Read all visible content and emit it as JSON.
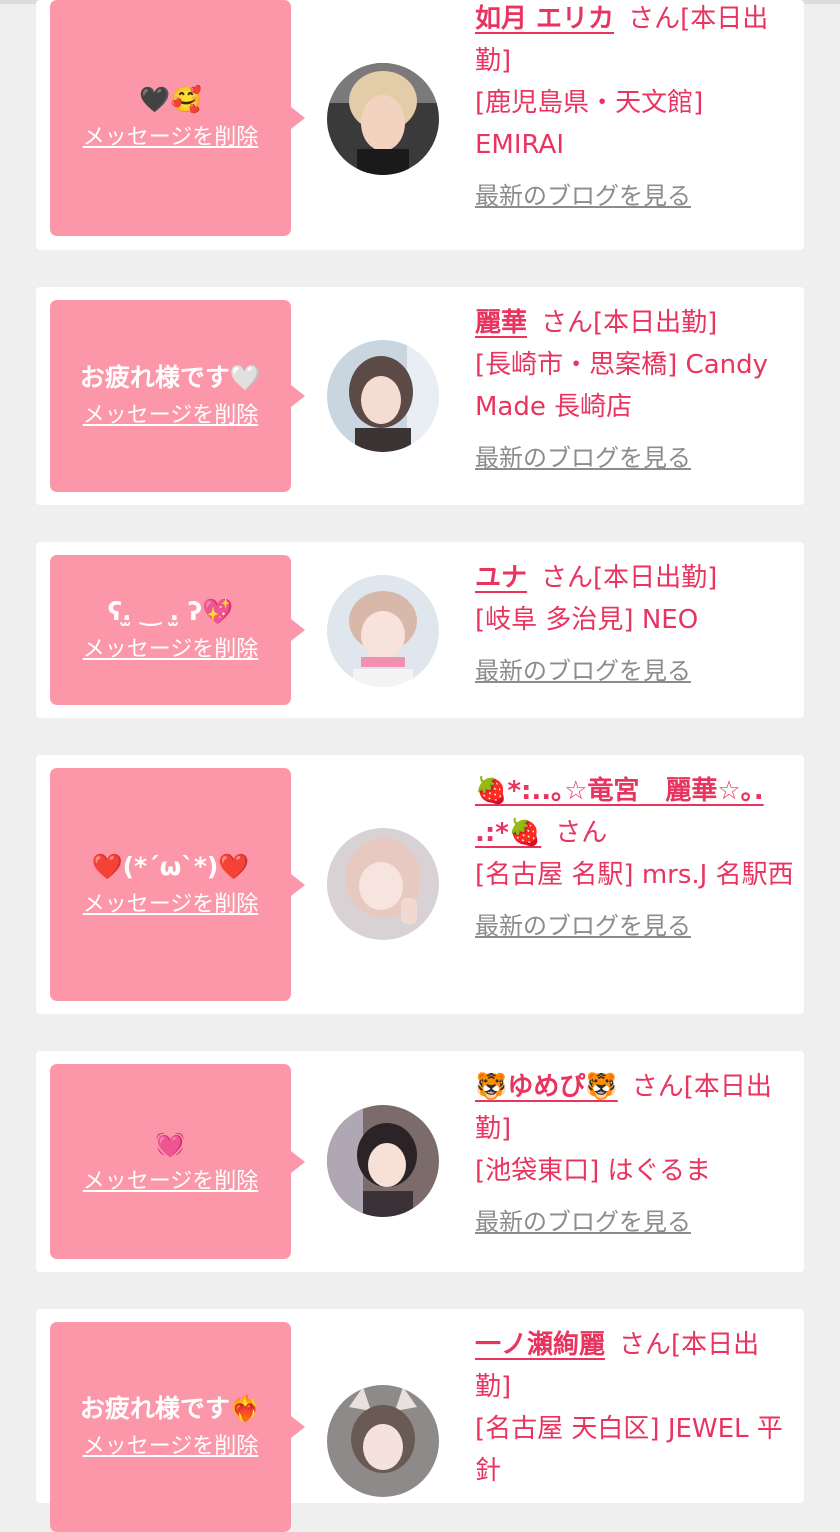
{
  "common": {
    "delete_label": "メッセージを削除",
    "blog_label": "最新のブログを見る"
  },
  "messages": [
    {
      "message": "🖤🥰",
      "name": "如月 エリカ",
      "san_attendance": "さん[本日出勤]",
      "shop": "[鹿児島県・天文館] EMIRAI"
    },
    {
      "message": "お疲れ様です🤍",
      "name": "麗華",
      "san_attendance": "さん[本日出勤]",
      "shop": "[長崎市・思案橋] Candy Made 長崎店"
    },
    {
      "message": "ʕ.̫ ‿ .̫ ʔ💖",
      "name": "ユナ",
      "san_attendance": "さん[本日出勤]",
      "shop": "[岐阜 多治見] NEO"
    },
    {
      "message": "❤️(*´ω`*)❤️",
      "name": "🍓*:..｡☆竜宮　麗華☆｡. .:*🍓",
      "san_attendance": "さん",
      "shop": "[名古屋 名駅] mrs.J 名駅西"
    },
    {
      "message": "💓",
      "name": "🐯ゆめぴ🐯",
      "san_attendance": "さん[本日出勤]",
      "shop": "[池袋東口] はぐるま"
    },
    {
      "message": "お疲れ様です❤️‍🔥",
      "name": "一ノ瀬絢麗",
      "san_attendance": "さん[本日出勤]",
      "shop": "[名古屋 天白区] JEWEL 平針"
    }
  ]
}
